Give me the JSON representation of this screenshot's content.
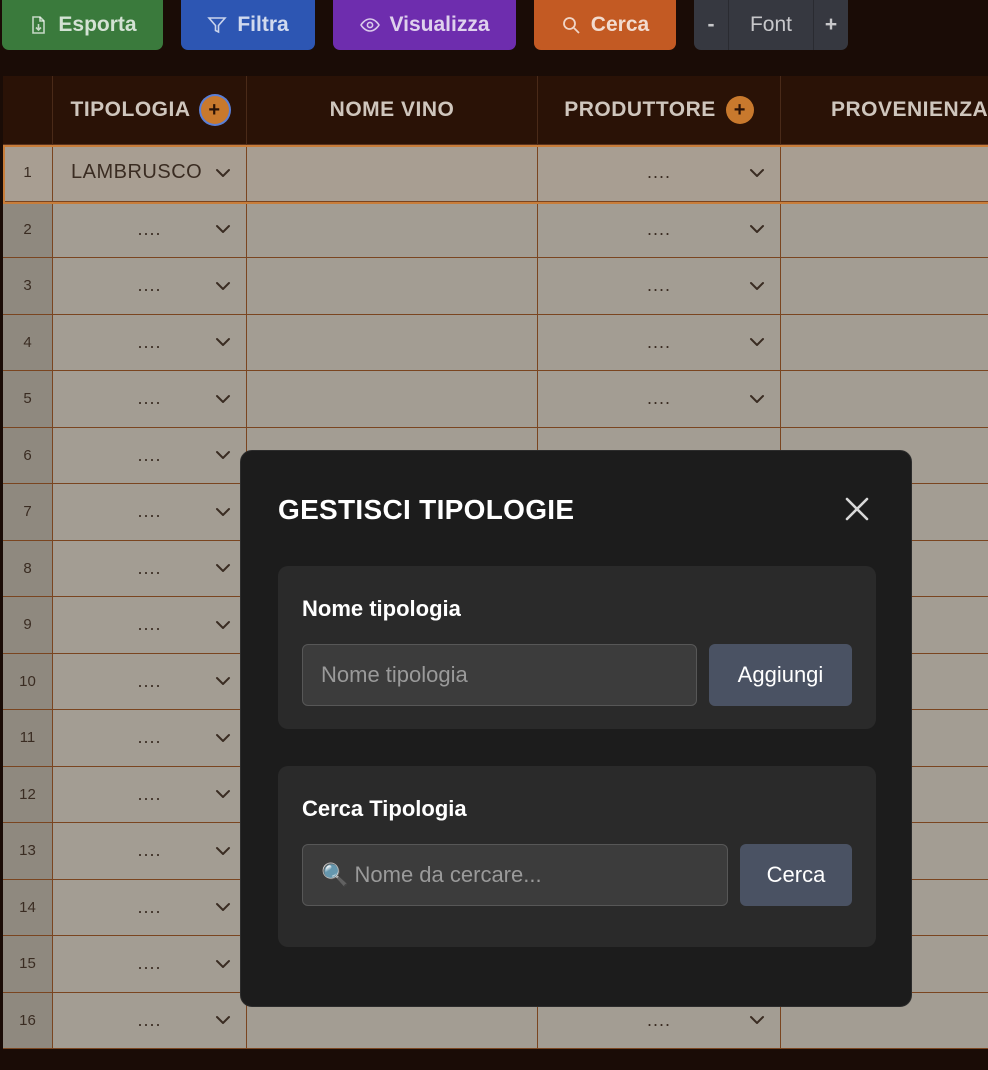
{
  "toolbar": {
    "esporta": "Esporta",
    "filtra": "Filtra",
    "visualizza": "Visualizza",
    "cerca": "Cerca",
    "font_minus": "-",
    "font_label": "Font",
    "font_plus": "+"
  },
  "table": {
    "headers": {
      "tipologia": "TIPOLOGIA",
      "nome_vino": "NOME VINO",
      "produttore": "PRODUTTORE",
      "provenienza": "PROVENIENZA"
    },
    "add_symbol": "+",
    "empty_value": "....",
    "rows": [
      {
        "num": "1",
        "tipologia": "LAMBRUSCO",
        "produttore": "...."
      },
      {
        "num": "2",
        "tipologia": "....",
        "produttore": "...."
      },
      {
        "num": "3",
        "tipologia": "....",
        "produttore": "...."
      },
      {
        "num": "4",
        "tipologia": "....",
        "produttore": "...."
      },
      {
        "num": "5",
        "tipologia": "....",
        "produttore": "...."
      },
      {
        "num": "6",
        "tipologia": "....",
        "produttore": "...."
      },
      {
        "num": "7",
        "tipologia": "....",
        "produttore": "...."
      },
      {
        "num": "8",
        "tipologia": "....",
        "produttore": "...."
      },
      {
        "num": "9",
        "tipologia": "....",
        "produttore": "...."
      },
      {
        "num": "10",
        "tipologia": "....",
        "produttore": "...."
      },
      {
        "num": "11",
        "tipologia": "....",
        "produttore": "...."
      },
      {
        "num": "12",
        "tipologia": "....",
        "produttore": "...."
      },
      {
        "num": "13",
        "tipologia": "....",
        "produttore": "...."
      },
      {
        "num": "14",
        "tipologia": "....",
        "produttore": "...."
      },
      {
        "num": "15",
        "tipologia": "....",
        "produttore": "...."
      },
      {
        "num": "16",
        "tipologia": "....",
        "produttore": "...."
      }
    ]
  },
  "modal": {
    "title": "GESTISCI TIPOLOGIE",
    "add_section": {
      "label": "Nome tipologia",
      "placeholder": "Nome tipologia",
      "button": "Aggiungi"
    },
    "search_section": {
      "label": "Cerca Tipologia",
      "placeholder": "🔍 Nome da cercare...",
      "button": "Cerca"
    }
  },
  "colors": {
    "esporta": "#3a7a3c",
    "filtra": "#2d56b3",
    "visualizza": "#6e2dae",
    "cerca": "#c35a23",
    "accent": "#c8792d"
  }
}
